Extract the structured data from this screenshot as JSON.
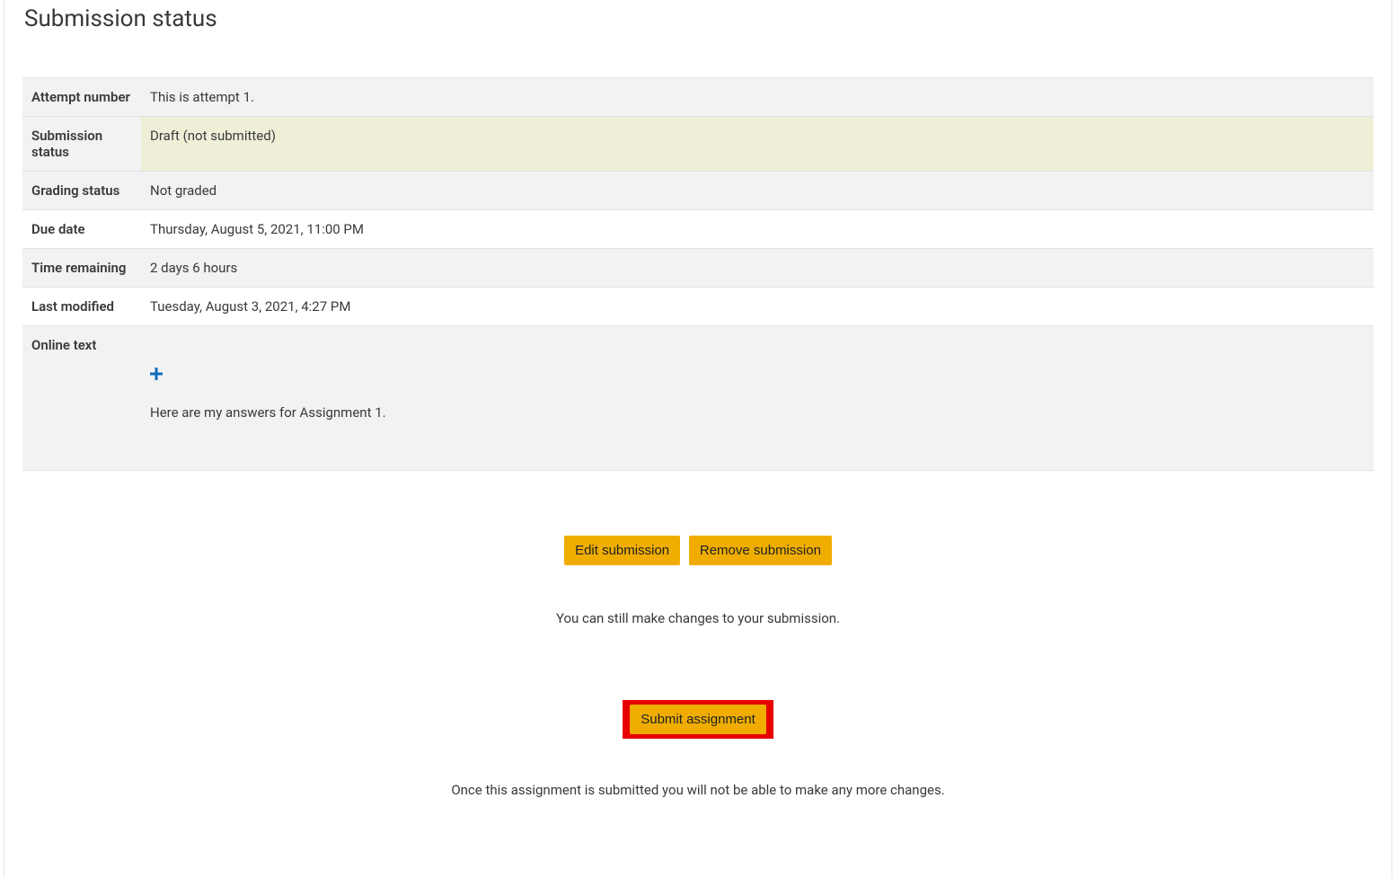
{
  "pageTitle": "Submission status",
  "rows": {
    "attemptNumber": {
      "label": "Attempt number",
      "value": "This is attempt 1."
    },
    "submissionStatus": {
      "label": "Submission status",
      "value": "Draft (not submitted)"
    },
    "gradingStatus": {
      "label": "Grading status",
      "value": "Not graded"
    },
    "dueDate": {
      "label": "Due date",
      "value": "Thursday, August 5, 2021, 11:00 PM"
    },
    "timeRemaining": {
      "label": "Time remaining",
      "value": "2 days 6 hours"
    },
    "lastModified": {
      "label": "Last modified",
      "value": "Tuesday, August 3, 2021, 4:27 PM"
    },
    "onlineText": {
      "label": "Online text",
      "value": "Here are my answers for Assignment 1."
    }
  },
  "buttons": {
    "edit": "Edit submission",
    "remove": "Remove submission",
    "submit": "Submit assignment"
  },
  "messages": {
    "canStillChange": "You can still make changes to your submission.",
    "onceSubmitted": "Once this assignment is submitted you will not be able to make any more changes."
  },
  "icons": {
    "plus": "plus-icon"
  }
}
